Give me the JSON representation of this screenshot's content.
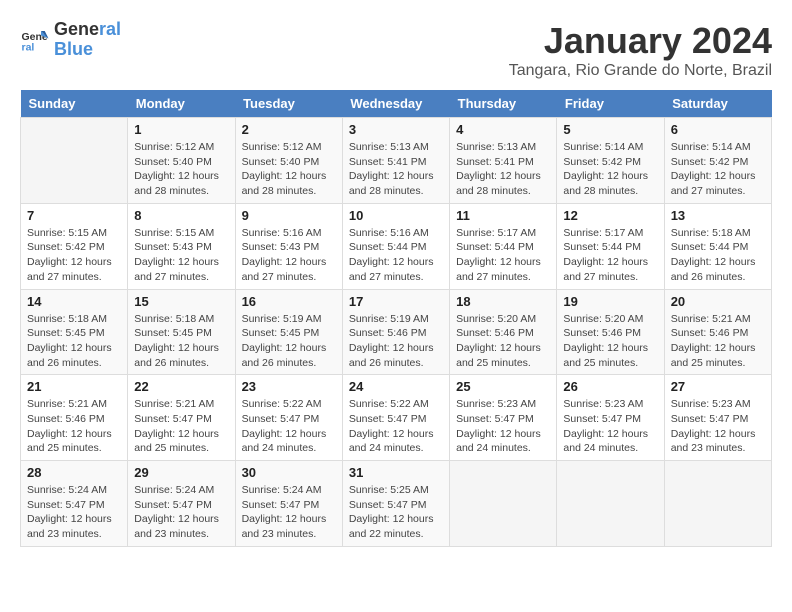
{
  "logo": {
    "line1": "General",
    "line2": "Blue"
  },
  "title": "January 2024",
  "subtitle": "Tangara, Rio Grande do Norte, Brazil",
  "days_header": [
    "Sunday",
    "Monday",
    "Tuesday",
    "Wednesday",
    "Thursday",
    "Friday",
    "Saturday"
  ],
  "weeks": [
    [
      {
        "day": "",
        "info": ""
      },
      {
        "day": "1",
        "info": "Sunrise: 5:12 AM\nSunset: 5:40 PM\nDaylight: 12 hours\nand 28 minutes."
      },
      {
        "day": "2",
        "info": "Sunrise: 5:12 AM\nSunset: 5:40 PM\nDaylight: 12 hours\nand 28 minutes."
      },
      {
        "day": "3",
        "info": "Sunrise: 5:13 AM\nSunset: 5:41 PM\nDaylight: 12 hours\nand 28 minutes."
      },
      {
        "day": "4",
        "info": "Sunrise: 5:13 AM\nSunset: 5:41 PM\nDaylight: 12 hours\nand 28 minutes."
      },
      {
        "day": "5",
        "info": "Sunrise: 5:14 AM\nSunset: 5:42 PM\nDaylight: 12 hours\nand 28 minutes."
      },
      {
        "day": "6",
        "info": "Sunrise: 5:14 AM\nSunset: 5:42 PM\nDaylight: 12 hours\nand 27 minutes."
      }
    ],
    [
      {
        "day": "7",
        "info": "Sunrise: 5:15 AM\nSunset: 5:42 PM\nDaylight: 12 hours\nand 27 minutes."
      },
      {
        "day": "8",
        "info": "Sunrise: 5:15 AM\nSunset: 5:43 PM\nDaylight: 12 hours\nand 27 minutes."
      },
      {
        "day": "9",
        "info": "Sunrise: 5:16 AM\nSunset: 5:43 PM\nDaylight: 12 hours\nand 27 minutes."
      },
      {
        "day": "10",
        "info": "Sunrise: 5:16 AM\nSunset: 5:44 PM\nDaylight: 12 hours\nand 27 minutes."
      },
      {
        "day": "11",
        "info": "Sunrise: 5:17 AM\nSunset: 5:44 PM\nDaylight: 12 hours\nand 27 minutes."
      },
      {
        "day": "12",
        "info": "Sunrise: 5:17 AM\nSunset: 5:44 PM\nDaylight: 12 hours\nand 27 minutes."
      },
      {
        "day": "13",
        "info": "Sunrise: 5:18 AM\nSunset: 5:44 PM\nDaylight: 12 hours\nand 26 minutes."
      }
    ],
    [
      {
        "day": "14",
        "info": "Sunrise: 5:18 AM\nSunset: 5:45 PM\nDaylight: 12 hours\nand 26 minutes."
      },
      {
        "day": "15",
        "info": "Sunrise: 5:18 AM\nSunset: 5:45 PM\nDaylight: 12 hours\nand 26 minutes."
      },
      {
        "day": "16",
        "info": "Sunrise: 5:19 AM\nSunset: 5:45 PM\nDaylight: 12 hours\nand 26 minutes."
      },
      {
        "day": "17",
        "info": "Sunrise: 5:19 AM\nSunset: 5:46 PM\nDaylight: 12 hours\nand 26 minutes."
      },
      {
        "day": "18",
        "info": "Sunrise: 5:20 AM\nSunset: 5:46 PM\nDaylight: 12 hours\nand 25 minutes."
      },
      {
        "day": "19",
        "info": "Sunrise: 5:20 AM\nSunset: 5:46 PM\nDaylight: 12 hours\nand 25 minutes."
      },
      {
        "day": "20",
        "info": "Sunrise: 5:21 AM\nSunset: 5:46 PM\nDaylight: 12 hours\nand 25 minutes."
      }
    ],
    [
      {
        "day": "21",
        "info": "Sunrise: 5:21 AM\nSunset: 5:46 PM\nDaylight: 12 hours\nand 25 minutes."
      },
      {
        "day": "22",
        "info": "Sunrise: 5:21 AM\nSunset: 5:47 PM\nDaylight: 12 hours\nand 25 minutes."
      },
      {
        "day": "23",
        "info": "Sunrise: 5:22 AM\nSunset: 5:47 PM\nDaylight: 12 hours\nand 24 minutes."
      },
      {
        "day": "24",
        "info": "Sunrise: 5:22 AM\nSunset: 5:47 PM\nDaylight: 12 hours\nand 24 minutes."
      },
      {
        "day": "25",
        "info": "Sunrise: 5:23 AM\nSunset: 5:47 PM\nDaylight: 12 hours\nand 24 minutes."
      },
      {
        "day": "26",
        "info": "Sunrise: 5:23 AM\nSunset: 5:47 PM\nDaylight: 12 hours\nand 24 minutes."
      },
      {
        "day": "27",
        "info": "Sunrise: 5:23 AM\nSunset: 5:47 PM\nDaylight: 12 hours\nand 23 minutes."
      }
    ],
    [
      {
        "day": "28",
        "info": "Sunrise: 5:24 AM\nSunset: 5:47 PM\nDaylight: 12 hours\nand 23 minutes."
      },
      {
        "day": "29",
        "info": "Sunrise: 5:24 AM\nSunset: 5:47 PM\nDaylight: 12 hours\nand 23 minutes."
      },
      {
        "day": "30",
        "info": "Sunrise: 5:24 AM\nSunset: 5:47 PM\nDaylight: 12 hours\nand 23 minutes."
      },
      {
        "day": "31",
        "info": "Sunrise: 5:25 AM\nSunset: 5:47 PM\nDaylight: 12 hours\nand 22 minutes."
      },
      {
        "day": "",
        "info": ""
      },
      {
        "day": "",
        "info": ""
      },
      {
        "day": "",
        "info": ""
      }
    ]
  ]
}
